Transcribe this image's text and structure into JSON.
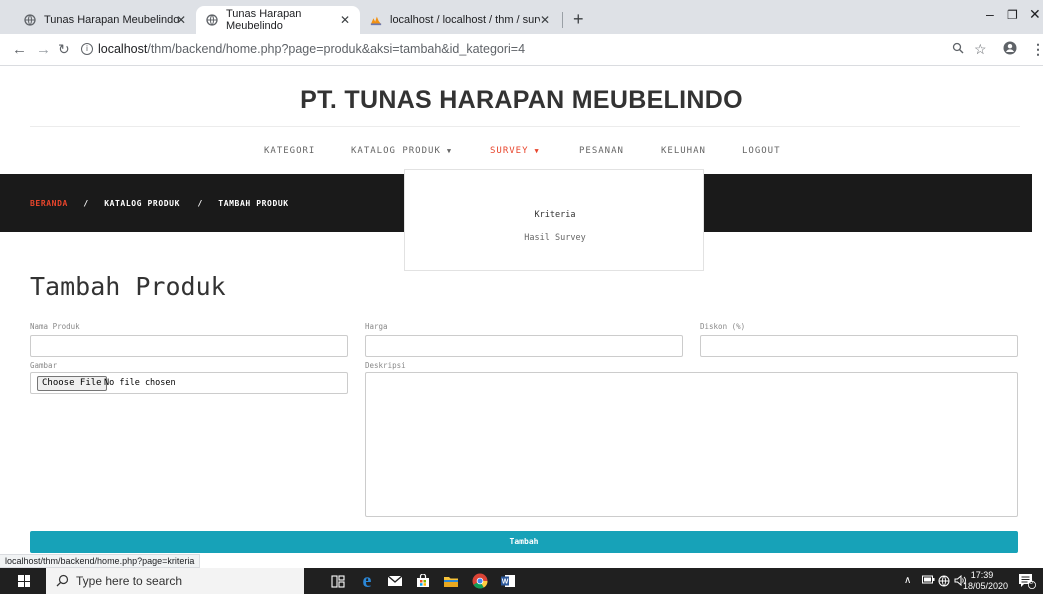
{
  "browser": {
    "tabs": [
      {
        "title": "Tunas Harapan Meubelindo"
      },
      {
        "title": "Tunas Harapan Meubelindo"
      },
      {
        "title": "localhost / localhost / thm / surv"
      }
    ],
    "url_host": "localhost",
    "url_rest": "/thm/backend/home.php?page=produk&aksi=tambah&id_kategori=4",
    "status_url": "localhost/thm/backend/home.php?page=kriteria"
  },
  "site": {
    "brand": "PT. TUNAS HARAPAN MEUBELINDO",
    "nav": {
      "kategori": "KATEGORI",
      "katalog": "KATALOG PRODUK",
      "survey": "SURVEY",
      "pesanan": "PESANAN",
      "keluhan": "KELUHAN",
      "logout": "LOGOUT"
    },
    "survey_menu": {
      "kriteria": "Kriteria",
      "hasil": "Hasil Survey"
    },
    "breadcrumb": {
      "home": "BERANDA",
      "katalog": "KATALOG PRODUK",
      "current": "TAMBAH PRODUK",
      "sep": "/"
    }
  },
  "form": {
    "title": "Tambah Produk",
    "nama_label": "Nama Produk",
    "harga_label": "Harga",
    "diskon_label": "Diskon (%)",
    "gambar_label": "Gambar",
    "deskripsi_label": "Deskripsi",
    "file_button": "Choose File",
    "file_status": "No file chosen",
    "nama_value": "",
    "harga_value": "",
    "diskon_value": "",
    "deskripsi_value": "",
    "submit": "Tambah"
  },
  "taskbar": {
    "search_placeholder": "Type here to search",
    "time": "17:39",
    "date": "18/05/2020",
    "notif_count": "6"
  },
  "colors": {
    "accent": "#e8452c",
    "button": "#17a2b8",
    "crumbbar": "#1a1a1a"
  }
}
